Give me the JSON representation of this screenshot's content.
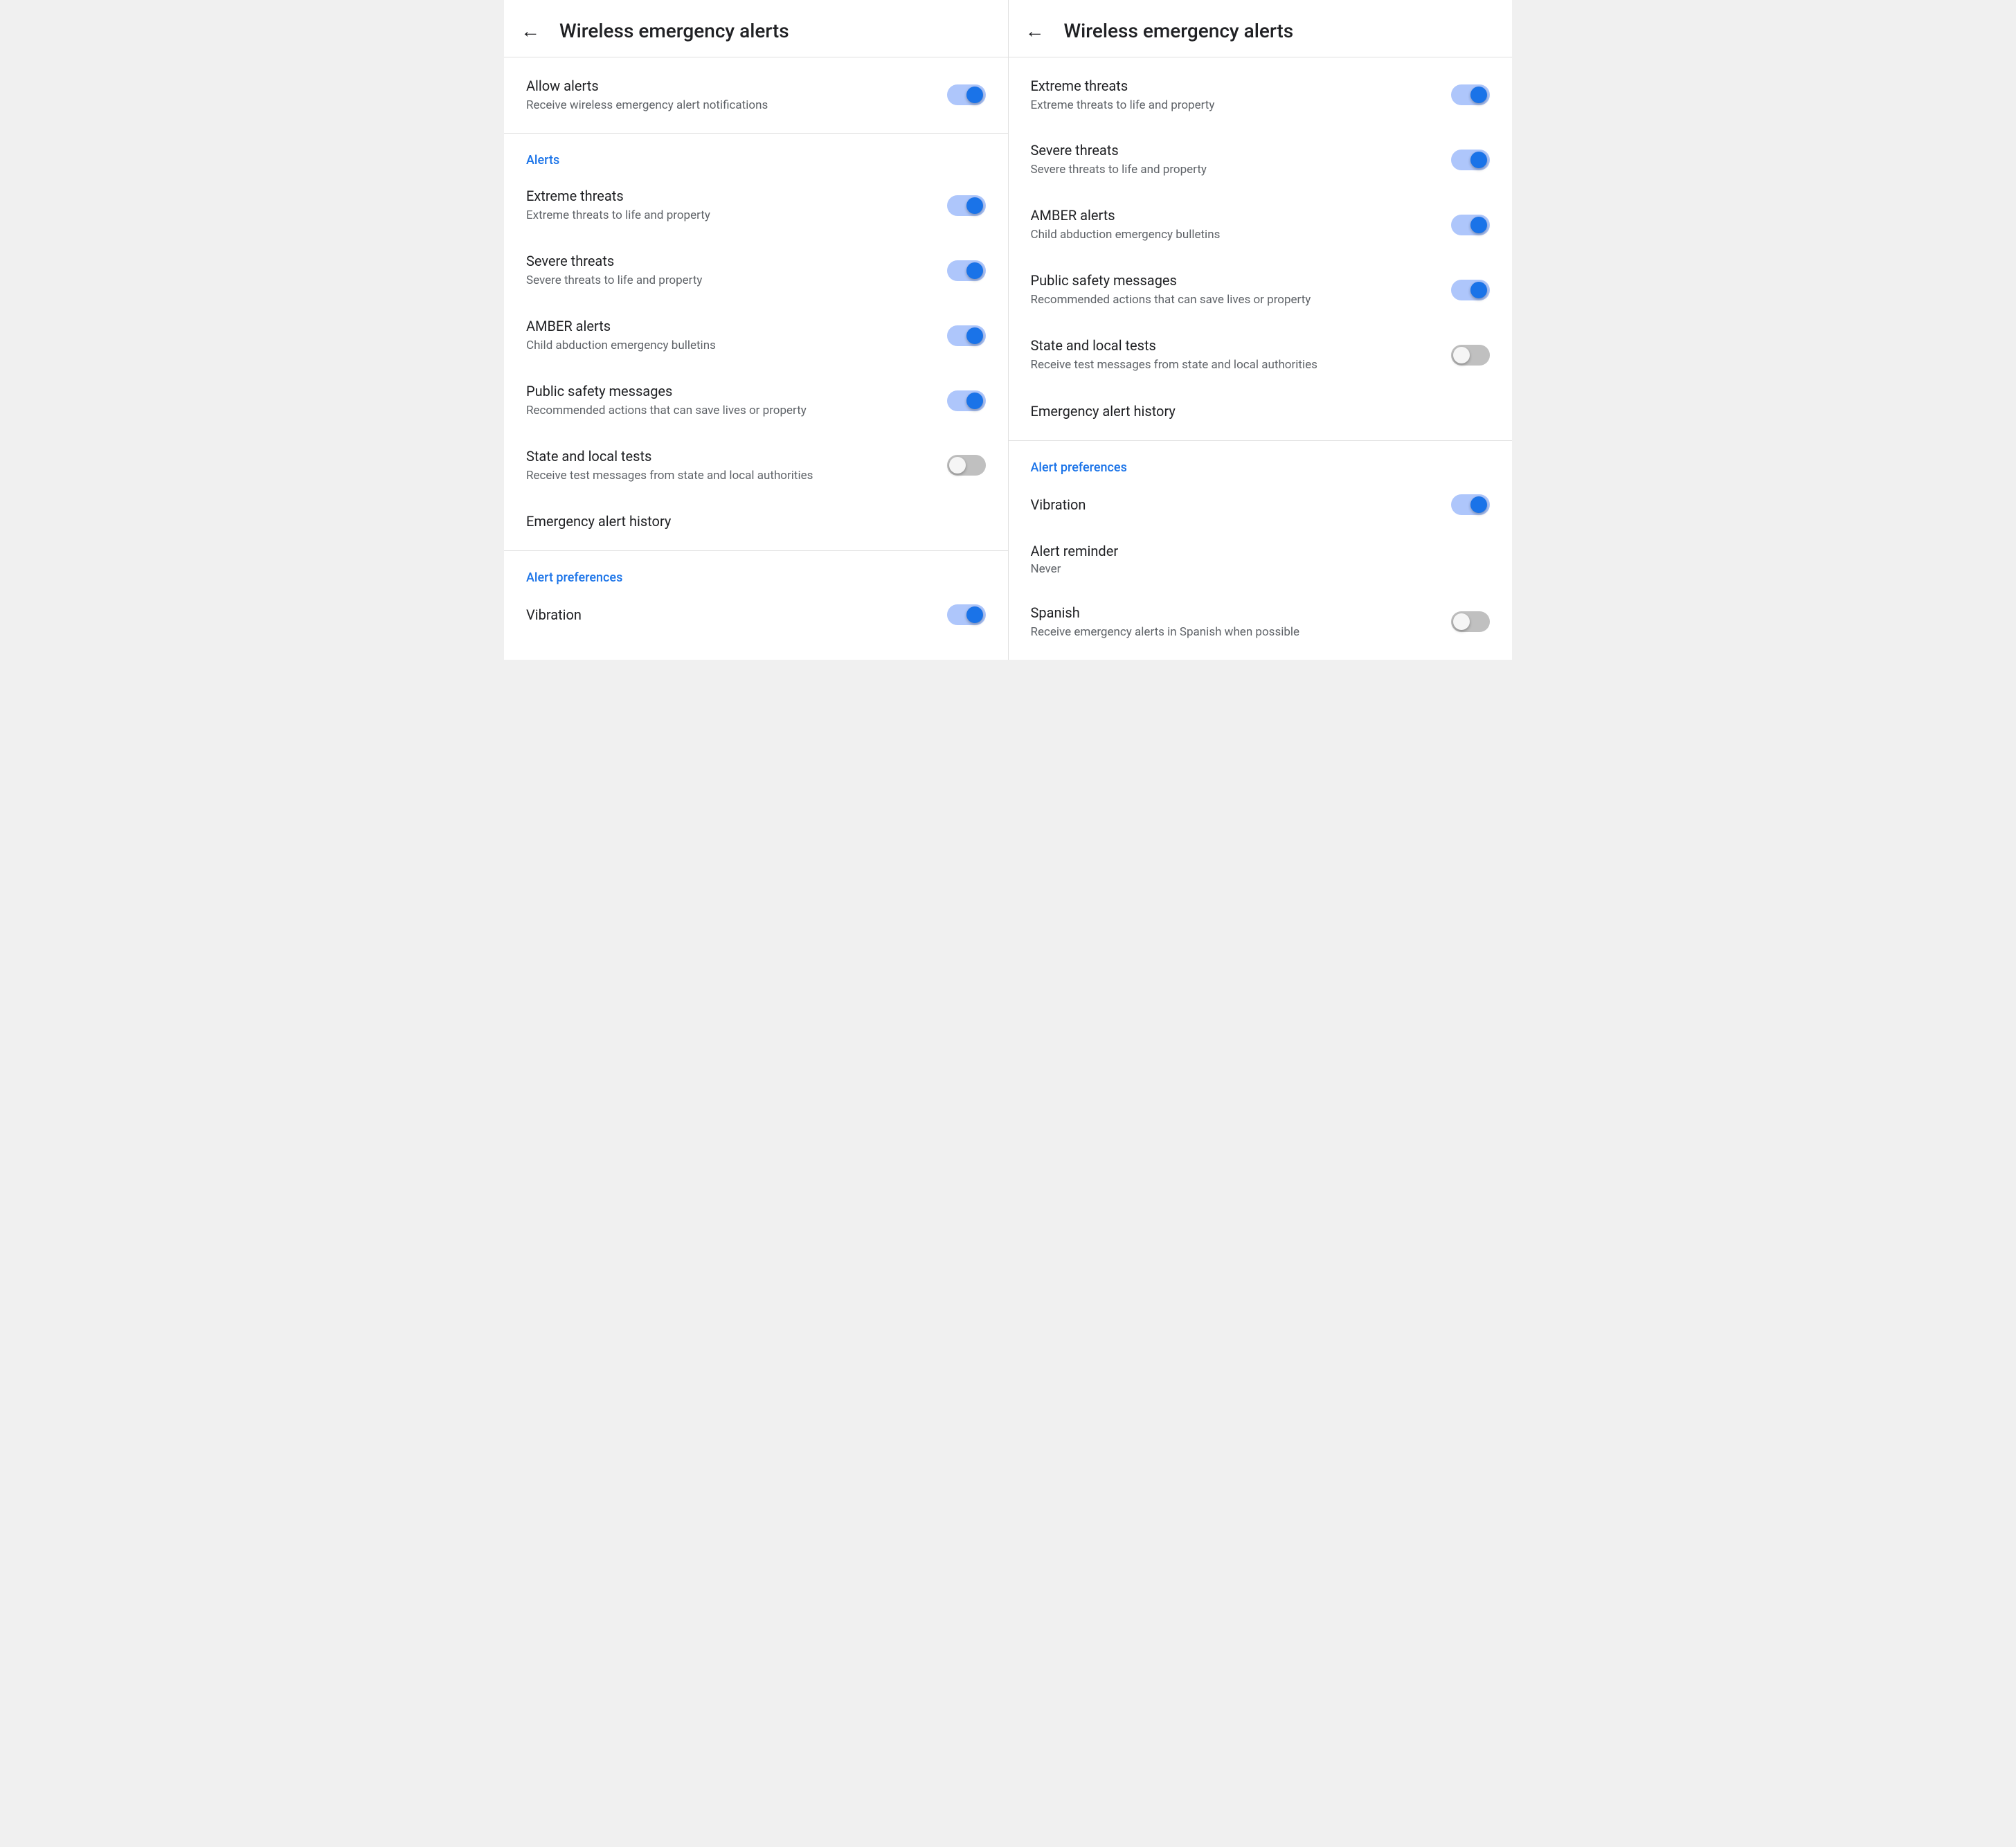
{
  "screens": [
    {
      "id": "screen-left",
      "header": {
        "back_label": "←",
        "title": "Wireless emergency alerts"
      },
      "sections": [
        {
          "id": "allow-section",
          "items": [
            {
              "type": "toggle",
              "name": "allow-alerts",
              "title": "Allow alerts",
              "subtitle": "Receive wireless emergency alert notifications",
              "state": "on"
            }
          ]
        },
        {
          "id": "alerts-section",
          "label": "Alerts",
          "items": [
            {
              "type": "toggle",
              "name": "extreme-threats",
              "title": "Extreme threats",
              "subtitle": "Extreme threats to life and property",
              "state": "on"
            },
            {
              "type": "toggle",
              "name": "severe-threats",
              "title": "Severe threats",
              "subtitle": "Severe threats to life and property",
              "state": "on"
            },
            {
              "type": "toggle",
              "name": "amber-alerts",
              "title": "AMBER alerts",
              "subtitle": "Child abduction emergency bulletins",
              "state": "on"
            },
            {
              "type": "toggle",
              "name": "public-safety",
              "title": "Public safety messages",
              "subtitle": "Recommended actions that can save lives or property",
              "state": "on"
            },
            {
              "type": "toggle",
              "name": "state-local-tests",
              "title": "State and local tests",
              "subtitle": "Receive test messages from state and local authorities",
              "state": "off"
            },
            {
              "type": "simple",
              "name": "emergency-history",
              "title": "Emergency alert history"
            }
          ]
        },
        {
          "id": "preferences-section",
          "label": "Alert preferences",
          "items": [
            {
              "type": "toggle",
              "name": "vibration",
              "title": "Vibration",
              "subtitle": "",
              "state": "on"
            }
          ]
        }
      ]
    },
    {
      "id": "screen-right",
      "header": {
        "back_label": "←",
        "title": "Wireless emergency alerts"
      },
      "sections": [
        {
          "id": "alerts-section-r",
          "items": [
            {
              "type": "toggle",
              "name": "extreme-threats-r",
              "title": "Extreme threats",
              "subtitle": "Extreme threats to life and property",
              "state": "on"
            },
            {
              "type": "toggle",
              "name": "severe-threats-r",
              "title": "Severe threats",
              "subtitle": "Severe threats to life and property",
              "state": "on"
            },
            {
              "type": "toggle",
              "name": "amber-alerts-r",
              "title": "AMBER alerts",
              "subtitle": "Child abduction emergency bulletins",
              "state": "on"
            },
            {
              "type": "toggle",
              "name": "public-safety-r",
              "title": "Public safety messages",
              "subtitle": "Recommended actions that can save lives or property",
              "state": "on"
            },
            {
              "type": "toggle",
              "name": "state-local-tests-r",
              "title": "State and local tests",
              "subtitle": "Receive test messages from state and local authorities",
              "state": "off"
            },
            {
              "type": "simple",
              "name": "emergency-history-r",
              "title": "Emergency alert history"
            }
          ]
        },
        {
          "id": "preferences-section-r",
          "label": "Alert preferences",
          "items": [
            {
              "type": "toggle",
              "name": "vibration-r",
              "title": "Vibration",
              "subtitle": "",
              "state": "on"
            },
            {
              "type": "value",
              "name": "alert-reminder",
              "title": "Alert reminder",
              "value": "Never"
            },
            {
              "type": "toggle",
              "name": "spanish",
              "title": "Spanish",
              "subtitle": "Receive emergency alerts in Spanish when possible",
              "state": "off"
            }
          ]
        }
      ]
    }
  ]
}
